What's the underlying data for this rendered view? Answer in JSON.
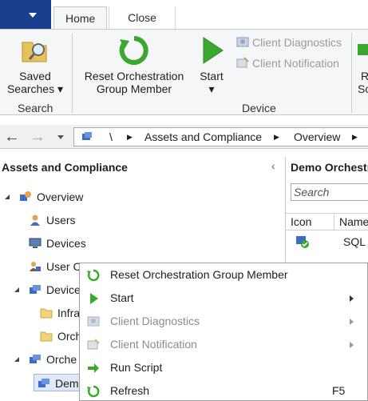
{
  "ribbon_tabs": [
    {
      "label": "Home",
      "active": true
    },
    {
      "label": "Close",
      "active": false
    }
  ],
  "ribbon": {
    "saved_searches_line1": "Saved",
    "saved_searches_line2": "Searches",
    "search_group": "Search",
    "reset_line1": "Reset Orchestration",
    "reset_line2": "Group Member",
    "start": "Start",
    "client_diagnostics": "Client Diagnostics",
    "client_notification": "Client Notification",
    "device_group": "Device",
    "partial_r": "R",
    "partial_sc": "Sc"
  },
  "address_bar": {
    "root": "\\",
    "crumb1": "Assets and Compliance",
    "crumb2": "Overview"
  },
  "left_pane": {
    "title": "Assets and Compliance",
    "tree": [
      {
        "label": "Overview"
      },
      {
        "label": "Users"
      },
      {
        "label": "Devices"
      },
      {
        "label": "User C"
      },
      {
        "label": "Device"
      },
      {
        "label": "Infra"
      },
      {
        "label": "Orch"
      },
      {
        "label": "Orche"
      },
      {
        "label": "Dem"
      }
    ]
  },
  "right_pane": {
    "title": "Demo Orchestr",
    "search_placeholder": "Search",
    "col_icon": "Icon",
    "col_name": "Name",
    "row1_name": "SQL"
  },
  "context_menu": [
    {
      "label": "Reset Orchestration Group Member",
      "enabled": true,
      "submenu": false,
      "shortcut": ""
    },
    {
      "label": "Start",
      "enabled": true,
      "submenu": true,
      "shortcut": ""
    },
    {
      "label": "Client Diagnostics",
      "enabled": false,
      "submenu": true,
      "shortcut": ""
    },
    {
      "label": "Client Notification",
      "enabled": false,
      "submenu": true,
      "shortcut": ""
    },
    {
      "label": "Run Script",
      "enabled": true,
      "submenu": false,
      "shortcut": ""
    },
    {
      "label": "Refresh",
      "enabled": true,
      "submenu": false,
      "shortcut": "F5"
    }
  ],
  "colors": {
    "app_menu": "#1b3f8f",
    "ribbon_bg": "#f5f6f7",
    "green_icon": "#3aa82e"
  }
}
